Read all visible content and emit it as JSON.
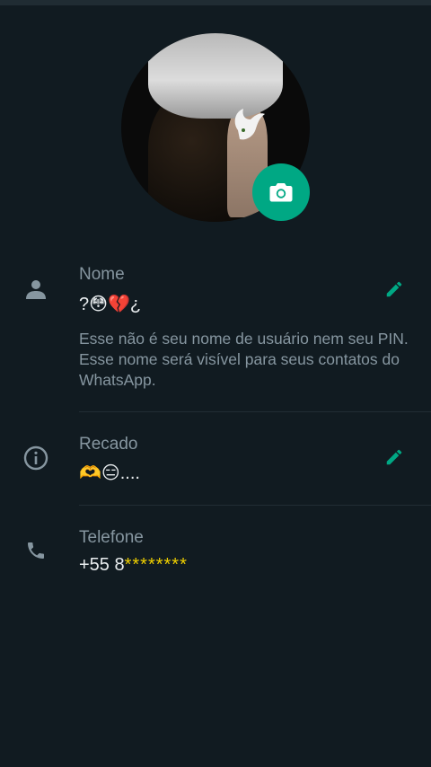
{
  "name_section": {
    "label": "Nome",
    "value": "?😳💔¿",
    "hint": "Esse não é seu nome de usuário nem seu PIN. Esse nome será visível para seus contatos do WhatsApp."
  },
  "about_section": {
    "label": "Recado",
    "value": "🫶😑...."
  },
  "phone_section": {
    "label": "Telefone",
    "value_prefix": "+55 8",
    "value_masked": "********"
  },
  "icons": {
    "camera": "camera-icon",
    "person": "person-icon",
    "info": "info-icon",
    "phone": "phone-icon",
    "edit": "pencil-icon"
  },
  "colors": {
    "background": "#111b21",
    "accent": "#00a884",
    "label": "#8696a0",
    "text": "#e9edef"
  }
}
